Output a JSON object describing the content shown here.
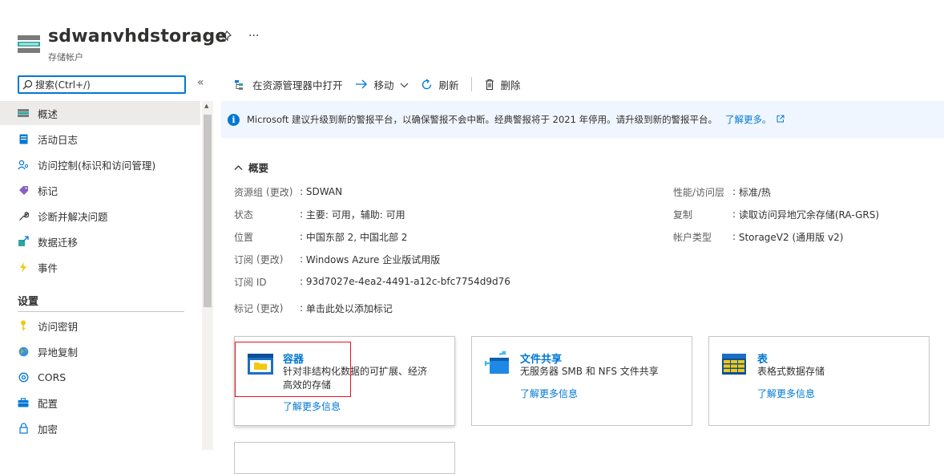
{
  "header": {
    "title": "sdwanvhdstorage",
    "subtitle": "存储帐户",
    "more": "···"
  },
  "search": {
    "text": "搜索(Ctrl+/)",
    "collapse": "«"
  },
  "sidebar": {
    "items": [
      {
        "label": "概述",
        "icon": "storage-overview-icon"
      },
      {
        "label": "活动日志",
        "icon": "activity-log-icon"
      },
      {
        "label": "访问控制(标识和访问管理)",
        "icon": "access-control-icon"
      },
      {
        "label": "标记",
        "icon": "tag-icon"
      },
      {
        "label": "诊断并解决问题",
        "icon": "wrench-icon"
      },
      {
        "label": "数据迁移",
        "icon": "data-migration-icon"
      },
      {
        "label": "事件",
        "icon": "lightning-icon"
      }
    ],
    "settings_header": "设置",
    "settings_items": [
      {
        "label": "访问密钥",
        "icon": "key-icon"
      },
      {
        "label": "异地复制",
        "icon": "globe-icon"
      },
      {
        "label": "CORS",
        "icon": "cors-icon"
      },
      {
        "label": "配置",
        "icon": "briefcase-icon"
      },
      {
        "label": "加密",
        "icon": "lock-icon"
      }
    ]
  },
  "toolbar": {
    "open_explorer": "在资源管理器中打开",
    "move": "移动",
    "refresh": "刷新",
    "delete": "删除"
  },
  "banner": {
    "text": "Microsoft 建议升级到新的警报平台，以确保警报不会中断。经典警报将于 2021 年停用。请升级到新的警报平台。",
    "link": "了解更多。"
  },
  "essentials": {
    "header": "概要",
    "change": "更改",
    "left": [
      {
        "label": "资源组",
        "has_change": true,
        "value": "SDWAN",
        "is_link": true
      },
      {
        "label": "状态",
        "has_change": false,
        "value": "主要: 可用，辅助: 可用",
        "is_link": false
      },
      {
        "label": "位置",
        "has_change": false,
        "value": "中国东部 2, 中国北部 2",
        "is_link": false
      },
      {
        "label": "订阅",
        "has_change": true,
        "value": "Windows Azure 企业版试用版",
        "is_link": true
      },
      {
        "label": "订阅 ID",
        "has_change": false,
        "value": "93d7027e-4ea2-4491-a12c-bfc7754d9d76",
        "is_link": false
      }
    ],
    "right": [
      {
        "label": "性能/访问层",
        "value": "标准/热"
      },
      {
        "label": "复制",
        "value": "读取访问异地冗余存储(RA-GRS)"
      },
      {
        "label": "帐户类型",
        "value": "StorageV2 (通用版 v2)"
      }
    ],
    "tags": {
      "label": "标记",
      "value": "单击此处以添加标记"
    }
  },
  "cards": [
    {
      "title": "容器",
      "desc1": "针对非结构化数据的可扩展、经济",
      "desc2": "高效的存储",
      "link": "了解更多信息",
      "icon": "container-icon"
    },
    {
      "title": "文件共享",
      "desc1": "无服务器 SMB 和 NFS 文件共享",
      "desc2": "",
      "link": "了解更多信息",
      "icon": "file-share-icon"
    },
    {
      "title": "表",
      "desc1": "表格式数据存储",
      "desc2": "",
      "link": "了解更多信息",
      "icon": "table-icon"
    }
  ],
  "colors": {
    "accent": "#0078d4",
    "highlight_box": "#e81123",
    "banner_bg": "#f0f6ff"
  }
}
